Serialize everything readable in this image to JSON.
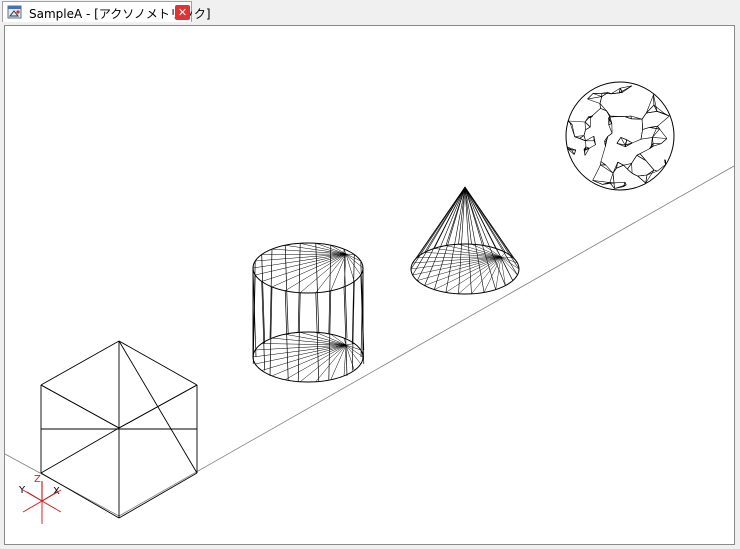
{
  "window": {
    "title": "SampleA - [アクソノメトリック]",
    "close_glyph": "✕",
    "icon": "cad-document-icon"
  },
  "view": {
    "projection": "axonometric",
    "objects": [
      "cube",
      "cylinder",
      "cone",
      "sphere"
    ],
    "colors": {
      "wire": "#000000",
      "ground": "#808080",
      "axis_x": "#000000",
      "axis_y": "#000000",
      "axis_z": "#e02020",
      "axis_red": "#e02020"
    }
  },
  "ucs": {
    "x_label": "X",
    "y_label": "Y",
    "z_label": "Z"
  }
}
